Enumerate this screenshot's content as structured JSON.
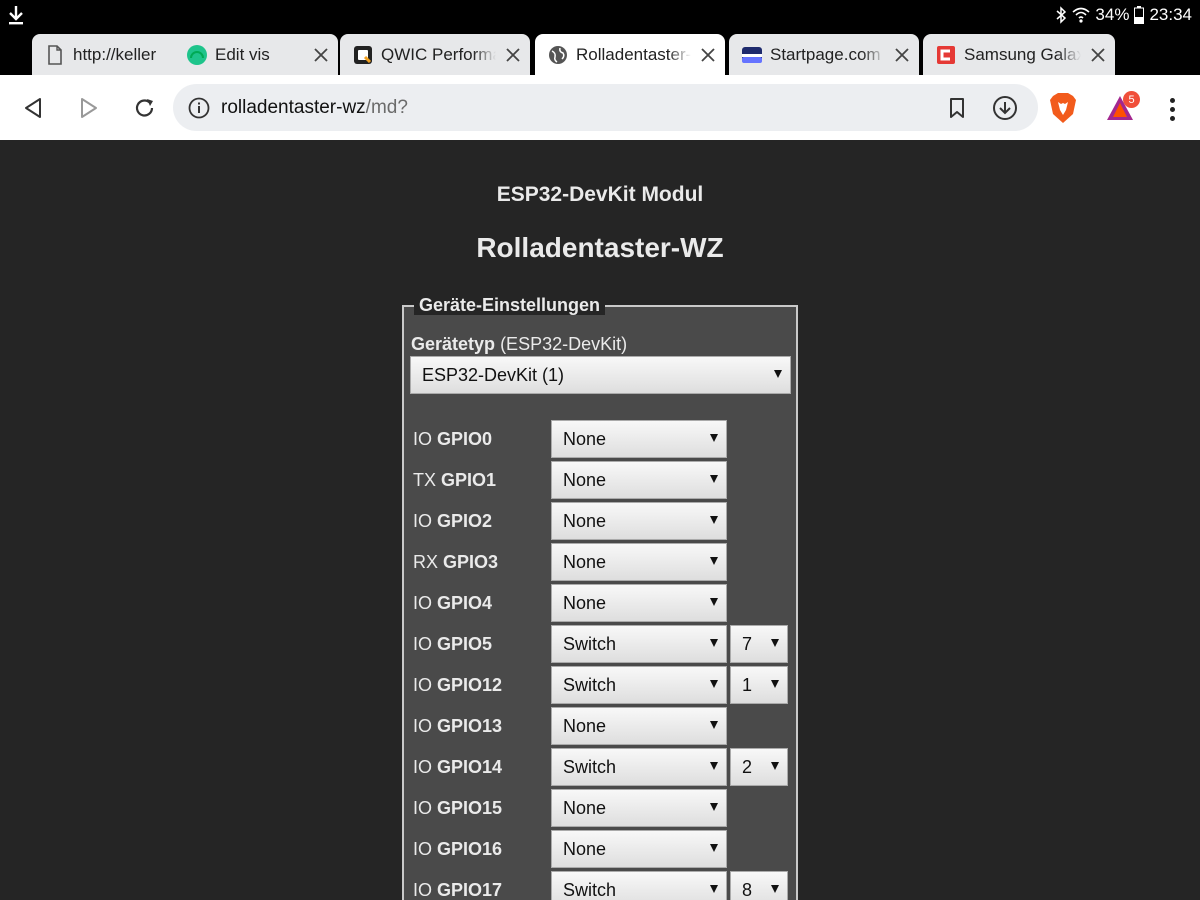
{
  "status_bar": {
    "battery": "34%",
    "time": "23:34"
  },
  "tabs": [
    {
      "title": "http://keller",
      "icon": "page-icon"
    },
    {
      "title": "Edit vis",
      "icon": "green-gauge-icon"
    },
    {
      "title": "QWIC Performance",
      "icon": "qwic-icon"
    },
    {
      "title": "Rolladentaster-WZ",
      "icon": "globe-icon",
      "active": true
    },
    {
      "title": "Startpage.com Search",
      "icon": "startpage-icon"
    },
    {
      "title": "Samsung Galaxy",
      "icon": "red-logo-icon"
    }
  ],
  "toolbar": {
    "url_host": "rolladentaster-wz",
    "url_path": "/md?",
    "rewards_badge": "5"
  },
  "page": {
    "module_title": "ESP32-DevKit Modul",
    "device_name": "Rolladentaster-WZ",
    "legend": "Geräte-Einstellungen",
    "device_type_label": "Gerätetyp",
    "device_type_hint": "(ESP32-DevKit)",
    "device_type_value": "ESP32-DevKit (1)",
    "gpio_rows": [
      {
        "prefix": "IO",
        "name": "GPIO0",
        "value": "None",
        "extra": ""
      },
      {
        "prefix": "TX",
        "name": "GPIO1",
        "value": "None",
        "extra": ""
      },
      {
        "prefix": "IO",
        "name": "GPIO2",
        "value": "None",
        "extra": ""
      },
      {
        "prefix": "RX",
        "name": "GPIO3",
        "value": "None",
        "extra": ""
      },
      {
        "prefix": "IO",
        "name": "GPIO4",
        "value": "None",
        "extra": ""
      },
      {
        "prefix": "IO",
        "name": "GPIO5",
        "value": "Switch",
        "extra": "7"
      },
      {
        "prefix": "IO",
        "name": "GPIO12",
        "value": "Switch",
        "extra": "1"
      },
      {
        "prefix": "IO",
        "name": "GPIO13",
        "value": "None",
        "extra": ""
      },
      {
        "prefix": "IO",
        "name": "GPIO14",
        "value": "Switch",
        "extra": "2"
      },
      {
        "prefix": "IO",
        "name": "GPIO15",
        "value": "None",
        "extra": ""
      },
      {
        "prefix": "IO",
        "name": "GPIO16",
        "value": "None",
        "extra": ""
      },
      {
        "prefix": "IO",
        "name": "GPIO17",
        "value": "Switch",
        "extra": "8"
      }
    ]
  }
}
